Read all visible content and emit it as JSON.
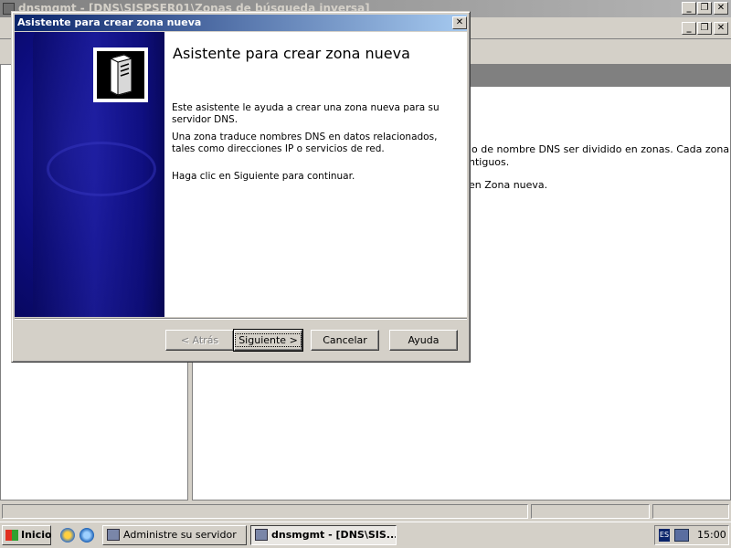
{
  "background_window": {
    "title": "dnsmgmt - [DNS\\SISPSER01\\Zonas de búsqueda inversa]",
    "details_text": [
      "io de nombre DNS ser dividido en zonas. Cada zona",
      "ntiguos.",
      "en Zona nueva."
    ]
  },
  "wizard": {
    "title": "Asistente para crear zona nueva",
    "heading": "Asistente para crear zona nueva",
    "paragraphs": [
      "Este asistente le ayuda a crear una zona nueva para su servidor DNS.",
      "Una zona traduce nombres DNS en datos relacionados, tales como direcciones IP o servicios de red.",
      "Haga clic en Siguiente para continuar."
    ],
    "buttons": {
      "back": "< Atrás",
      "next": "Siguiente >",
      "cancel": "Cancelar",
      "help": "Ayuda"
    }
  },
  "taskbar": {
    "start_label": "Inicio",
    "tasks": [
      "Administre su servidor",
      "dnsmgmt - [DNS\\SIS..."
    ],
    "language": "ES",
    "clock": "15:00"
  }
}
